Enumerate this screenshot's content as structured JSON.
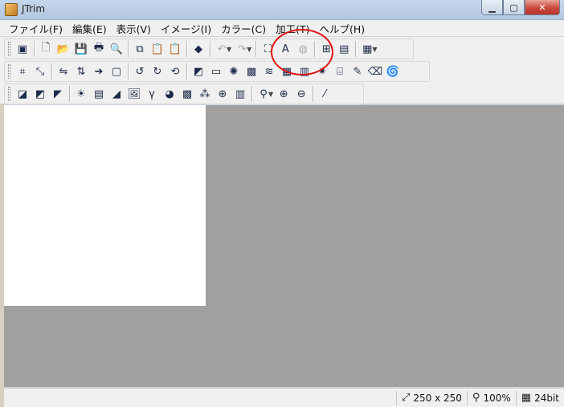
{
  "window": {
    "title": "JTrim"
  },
  "menu": [
    "ファイル(F)",
    "編集(E)",
    "表示(V)",
    "イメージ(I)",
    "カラー(C)",
    "加工(T)",
    "ヘルプ(H)"
  ],
  "toolbar1": [
    {
      "name": "new-window-icon",
      "glyph": "▣"
    },
    {
      "sep": true
    },
    {
      "name": "new-file-icon",
      "glyph": "🗋"
    },
    {
      "name": "open-folder-icon",
      "glyph": "📂"
    },
    {
      "name": "save-icon",
      "glyph": "💾"
    },
    {
      "name": "print-icon",
      "glyph": "🖶"
    },
    {
      "name": "print-preview-icon",
      "glyph": "🔍"
    },
    {
      "sep": true
    },
    {
      "name": "copy-icon",
      "glyph": "⧉"
    },
    {
      "name": "paste-icon",
      "glyph": "📋"
    },
    {
      "name": "paste-new-icon",
      "glyph": "📋"
    },
    {
      "sep": true
    },
    {
      "name": "capture-icon",
      "glyph": "◆"
    },
    {
      "sep": true
    },
    {
      "name": "undo-icon",
      "glyph": "↶",
      "disabled": true,
      "dropdown": true
    },
    {
      "name": "redo-icon",
      "glyph": "↷",
      "disabled": true,
      "dropdown": true
    },
    {
      "sep": true
    },
    {
      "name": "select-area-icon",
      "glyph": "⛶"
    },
    {
      "name": "text-icon",
      "glyph": "A"
    },
    {
      "name": "circle-icon",
      "glyph": "◍",
      "disabled": true
    },
    {
      "sep": true
    },
    {
      "name": "grid-view-icon",
      "glyph": "⊞"
    },
    {
      "name": "filmstrip-icon",
      "glyph": "▤"
    },
    {
      "sep": true
    },
    {
      "name": "thumbnail-grid-icon",
      "glyph": "▦",
      "dropdown": true
    }
  ],
  "toolbar2": [
    {
      "name": "crop-icon",
      "glyph": "⌗"
    },
    {
      "name": "resize-icon",
      "glyph": "⤡"
    },
    {
      "sep": true
    },
    {
      "name": "flip-horizontal-icon",
      "glyph": "⇋"
    },
    {
      "name": "flip-vertical-icon",
      "glyph": "⇅"
    },
    {
      "name": "arrow-right-icon",
      "glyph": "➔"
    },
    {
      "name": "frame-icon",
      "glyph": "▢"
    },
    {
      "sep": true
    },
    {
      "name": "rotate-left-90-icon",
      "glyph": "↺"
    },
    {
      "name": "rotate-right-90-icon",
      "glyph": "↻"
    },
    {
      "name": "rotate-free-icon",
      "glyph": "⟲"
    },
    {
      "sep": true
    },
    {
      "name": "shadow-icon",
      "glyph": "◩"
    },
    {
      "name": "bevel-icon",
      "glyph": "▭"
    },
    {
      "name": "glow-icon",
      "glyph": "✺"
    },
    {
      "name": "noise-icon",
      "glyph": "▩"
    },
    {
      "name": "wave-icon",
      "glyph": "≋"
    },
    {
      "name": "mosaic-icon",
      "glyph": "▦"
    },
    {
      "name": "emboss-icon",
      "glyph": "▥"
    },
    {
      "name": "blur-icon",
      "glyph": "✷"
    },
    {
      "name": "edge-icon",
      "glyph": "⌸"
    },
    {
      "name": "pen-icon",
      "glyph": "✎"
    },
    {
      "name": "eraser-icon",
      "glyph": "⌫"
    },
    {
      "name": "swirl-icon",
      "glyph": "🌀"
    }
  ],
  "toolbar3": [
    {
      "name": "grayscale-icon",
      "glyph": "◪"
    },
    {
      "name": "sepia-icon",
      "glyph": "◩"
    },
    {
      "name": "negative-icon",
      "glyph": "◤"
    },
    {
      "sep": true
    },
    {
      "name": "brightness-icon",
      "glyph": "☀"
    },
    {
      "name": "color-balance-icon",
      "glyph": "▤"
    },
    {
      "name": "contrast-icon",
      "glyph": "◢"
    },
    {
      "name": "photo-icon",
      "glyph": "🖼"
    },
    {
      "name": "gamma-icon",
      "glyph": "γ"
    },
    {
      "name": "hue-icon",
      "glyph": "◕"
    },
    {
      "name": "checker-icon",
      "glyph": "▩"
    },
    {
      "name": "rgb-icon",
      "glyph": "⁂"
    },
    {
      "name": "xor-icon",
      "glyph": "⊕"
    },
    {
      "name": "posterize-icon",
      "glyph": "▥"
    },
    {
      "sep": true
    },
    {
      "name": "zoom-icon",
      "glyph": "⚲",
      "dropdown": true
    },
    {
      "name": "zoom-in-icon",
      "glyph": "⊕"
    },
    {
      "name": "zoom-out-icon",
      "glyph": "⊖"
    },
    {
      "sep": true
    },
    {
      "name": "eyedropper-icon",
      "glyph": "⁄"
    }
  ],
  "status": {
    "size": "250 x 250",
    "zoom": "100%",
    "depth": "24bit"
  }
}
